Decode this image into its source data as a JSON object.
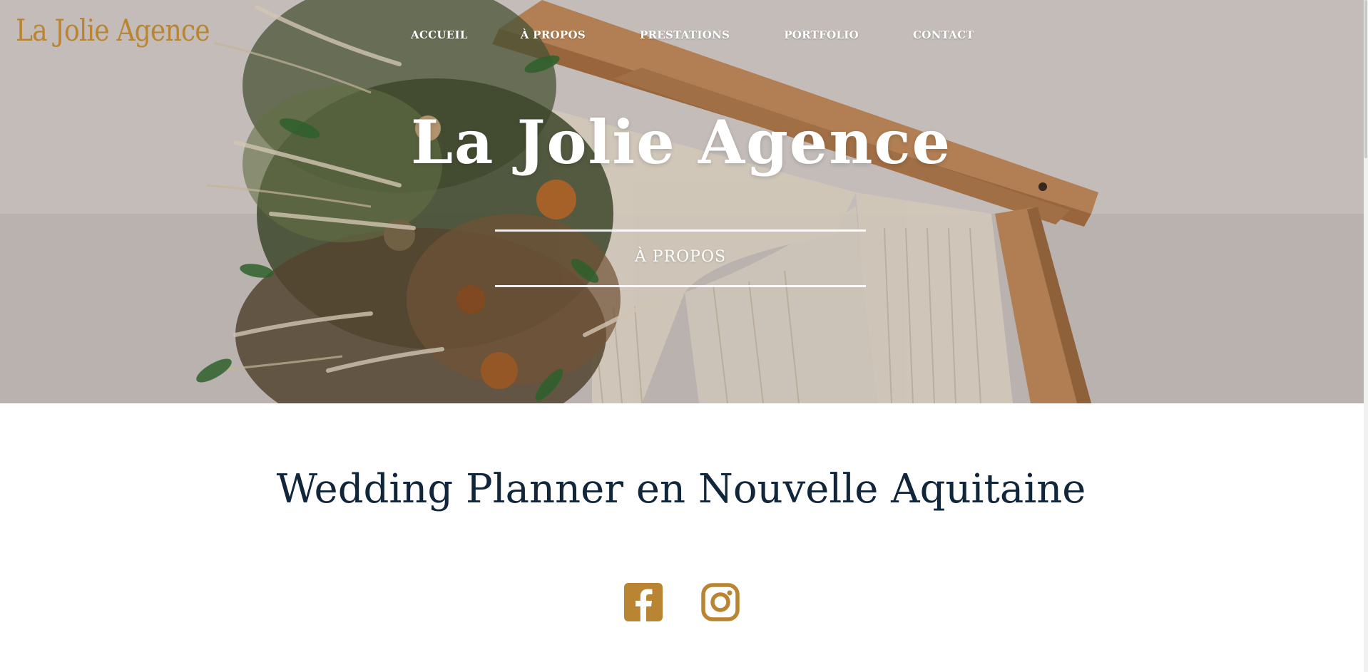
{
  "header": {
    "logo_text": "La Jolie Agence",
    "nav": [
      {
        "label": "ACCUEIL"
      },
      {
        "label": "À PROPOS"
      },
      {
        "label": "PRESTATIONS"
      },
      {
        "label": "PORTFOLIO"
      },
      {
        "label": "CONTACT"
      }
    ]
  },
  "hero": {
    "title": "La Jolie Agence",
    "subtitle": "À PROPOS"
  },
  "main": {
    "heading": "Wedding Planner en Nouvelle Aquitaine"
  },
  "socials": [
    {
      "icon": "facebook-icon"
    },
    {
      "icon": "instagram-icon"
    }
  ],
  "colors": {
    "brand_gold": "#b98532",
    "heading_navy": "#11263a",
    "hero_text": "#ffffff"
  }
}
